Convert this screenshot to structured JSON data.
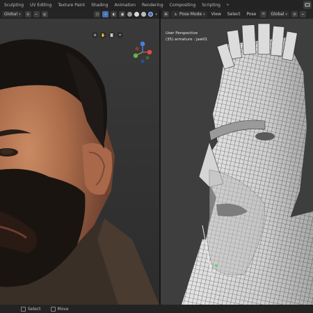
{
  "workspace_tabs": [
    "Sculpting",
    "UV Editing",
    "Texture Paint",
    "Shading",
    "Animation",
    "Rendering",
    "Compositing",
    "Scripting"
  ],
  "add_tab": "+",
  "left_viewport": {
    "orientation": "Global"
  },
  "right_viewport": {
    "mode": "Pose Mode",
    "menus": [
      "View",
      "Select",
      "Pose"
    ],
    "orientation": "Global",
    "view_name": "User Perspective",
    "object_info": "(35) armature : jaw01"
  },
  "statusbar": {
    "items": [
      "Select",
      "Move"
    ]
  },
  "colors": {
    "x_axis": "#e04a4a",
    "y_axis": "#6ab04c",
    "z_axis": "#4a7fe0",
    "active": "#4772b3"
  }
}
